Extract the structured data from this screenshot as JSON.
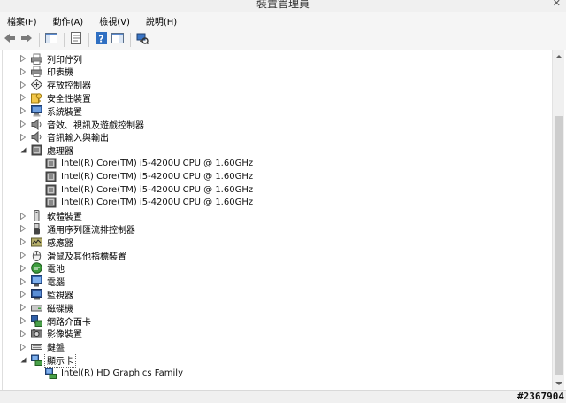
{
  "window": {
    "title": "裝置管理員"
  },
  "menu": [
    {
      "name": "menu-file",
      "label": "檔案(F)"
    },
    {
      "name": "menu-action",
      "label": "動作(A)"
    },
    {
      "name": "menu-view",
      "label": "檢視(V)"
    },
    {
      "name": "menu-help",
      "label": "說明(H)"
    }
  ],
  "toolbar": [
    {
      "name": "back-button",
      "icon": "back-arrow-icon"
    },
    {
      "name": "forward-button",
      "icon": "forward-arrow-icon"
    },
    {
      "sep": true
    },
    {
      "name": "show-hide-tree-button",
      "icon": "console-tree-icon"
    },
    {
      "sep": true
    },
    {
      "name": "properties-button",
      "icon": "properties-icon"
    },
    {
      "sep": true
    },
    {
      "name": "help-button",
      "icon": "help-icon"
    },
    {
      "name": "action-pane-button",
      "icon": "action-pane-icon"
    },
    {
      "sep": true
    },
    {
      "name": "scan-hardware-button",
      "icon": "scan-hardware-icon"
    }
  ],
  "tree": [
    {
      "label": "列印佇列",
      "icon": "printer-icon",
      "expanded": false,
      "level": 0
    },
    {
      "label": "印表機",
      "icon": "printer-icon",
      "expanded": false,
      "level": 0
    },
    {
      "label": "存放控制器",
      "icon": "storage-controller-icon",
      "expanded": false,
      "level": 0
    },
    {
      "label": "安全性裝置",
      "icon": "security-key-icon",
      "expanded": false,
      "level": 0
    },
    {
      "label": "系統裝置",
      "icon": "system-device-icon",
      "expanded": false,
      "level": 0
    },
    {
      "label": "音效、視訊及遊戲控制器",
      "icon": "speaker-icon",
      "expanded": false,
      "level": 0
    },
    {
      "label": "音訊輸入與輸出",
      "icon": "speaker-icon",
      "expanded": false,
      "level": 0
    },
    {
      "label": "處理器",
      "icon": "processor-icon",
      "expanded": true,
      "level": 0
    },
    {
      "label": "Intel(R) Core(TM) i5-4200U CPU @ 1.60GHz",
      "icon": "processor-icon",
      "level": 1
    },
    {
      "label": "Intel(R) Core(TM) i5-4200U CPU @ 1.60GHz",
      "icon": "processor-icon",
      "level": 1
    },
    {
      "label": "Intel(R) Core(TM) i5-4200U CPU @ 1.60GHz",
      "icon": "processor-icon",
      "level": 1
    },
    {
      "label": "Intel(R) Core(TM) i5-4200U CPU @ 1.60GHz",
      "icon": "processor-icon",
      "level": 1
    },
    {
      "label": "軟體裝置",
      "icon": "software-device-icon",
      "expanded": false,
      "level": 0
    },
    {
      "label": "通用序列匯流排控制器",
      "icon": "usb-icon",
      "expanded": false,
      "level": 0
    },
    {
      "label": "感應器",
      "icon": "sensor-icon",
      "expanded": false,
      "level": 0
    },
    {
      "label": "滑鼠及其他指標裝置",
      "icon": "mouse-icon",
      "expanded": false,
      "level": 0
    },
    {
      "label": "電池",
      "icon": "battery-icon",
      "expanded": false,
      "level": 0
    },
    {
      "label": "電腦",
      "icon": "computer-icon",
      "expanded": false,
      "level": 0
    },
    {
      "label": "監視器",
      "icon": "monitor-icon",
      "expanded": false,
      "level": 0
    },
    {
      "label": "磁碟機",
      "icon": "disk-drive-icon",
      "expanded": false,
      "level": 0
    },
    {
      "label": "網路介面卡",
      "icon": "network-adapter-icon",
      "expanded": false,
      "level": 0
    },
    {
      "label": "影像裝置",
      "icon": "camera-icon",
      "expanded": false,
      "level": 0
    },
    {
      "label": "鍵盤",
      "icon": "keyboard-icon",
      "expanded": false,
      "level": 0
    },
    {
      "label": "顯示卡",
      "icon": "display-adapter-icon",
      "expanded": true,
      "level": 0,
      "selected": true
    },
    {
      "label": "Intel(R) HD Graphics Family",
      "icon": "display-adapter-icon",
      "level": 1
    }
  ],
  "watermark": "#2367904",
  "colors": {
    "accent_blue": "#2f6fc2",
    "window_bg": "#f5f5f5"
  }
}
